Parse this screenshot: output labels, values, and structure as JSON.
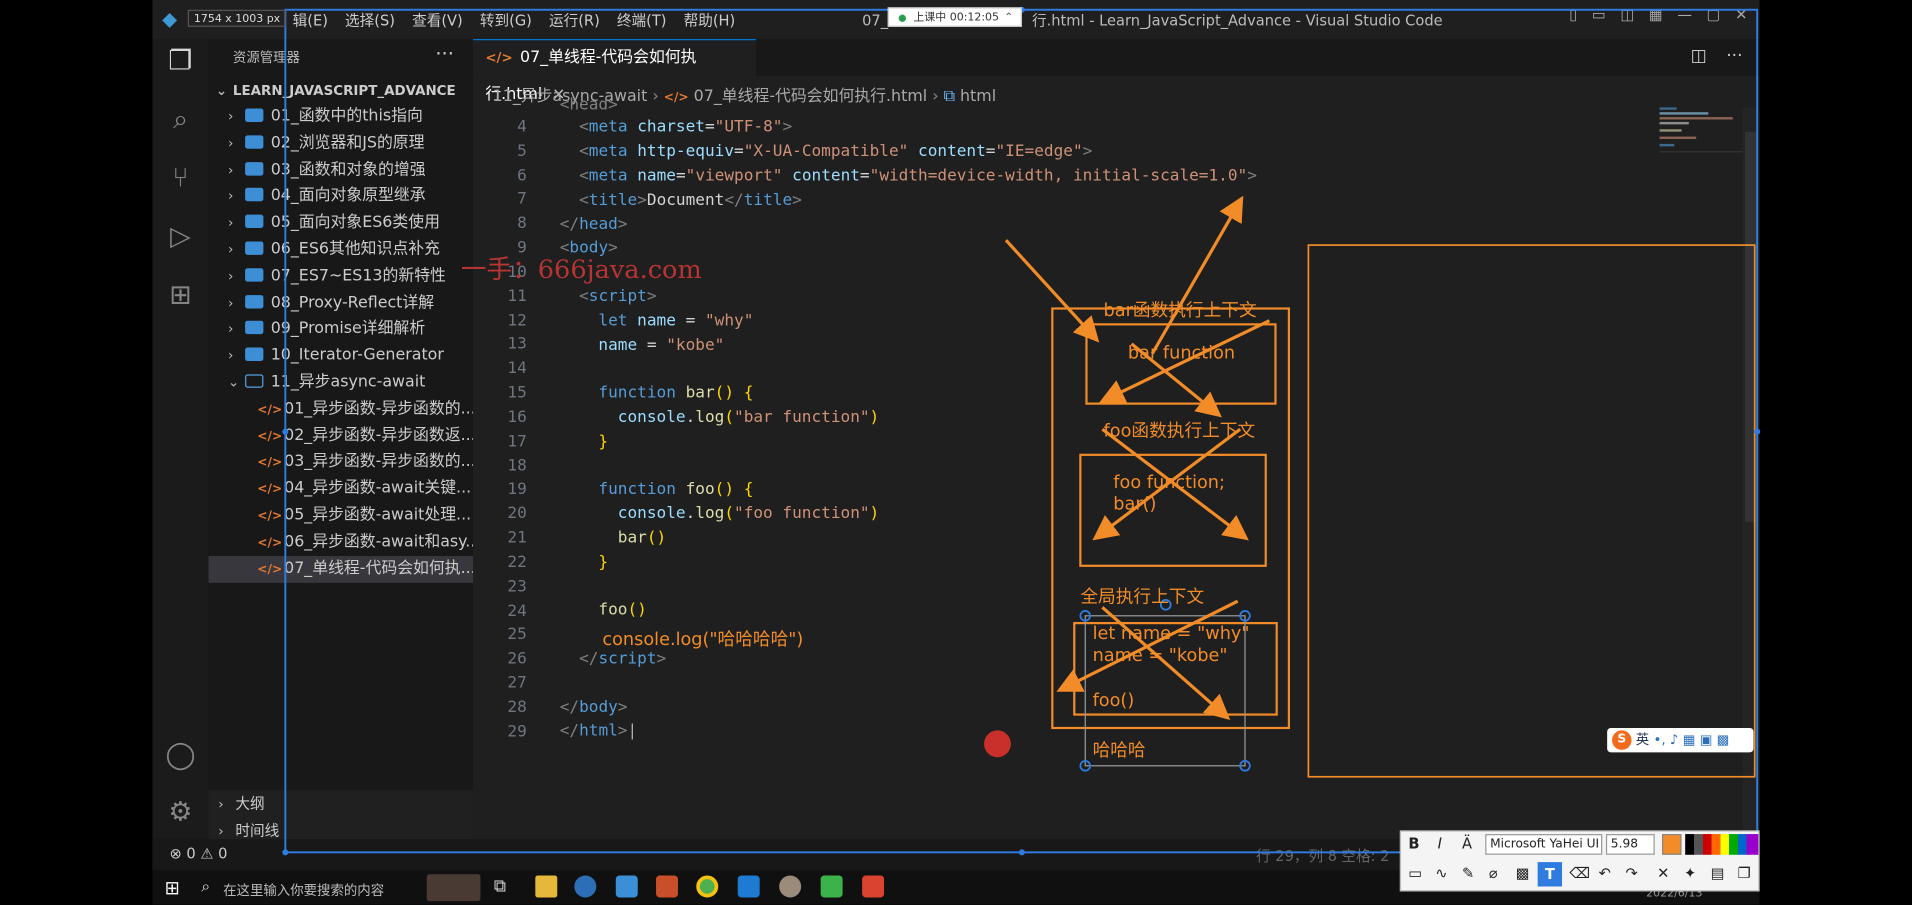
{
  "window": {
    "title": "07_单线程-代码会如何执行.html - Learn_JavaScript_Advance - Visual Studio Code",
    "title_visible": "行.html - Learn_JavaScript_Advance - Visual Studio Code",
    "menus": [
      "辑(E)",
      "选择(S)",
      "查看(V)",
      "转到(G)",
      "运行(R)",
      "终端(T)",
      "帮助(H)"
    ],
    "prefix": "07_"
  },
  "overlay": {
    "dimensions": "1754 x 1003  px",
    "timer_label": "上课中 00:12:05",
    "watermark": "一手：666java.com",
    "ime_label": "英",
    "ime_logo": "S"
  },
  "sidebar": {
    "title": "资源管理器",
    "more": "···",
    "root": "LEARN_JAVASCRIPT_ADVANCE",
    "folders": [
      "01_函数中的this指向",
      "02_浏览器和JS的原理",
      "03_函数和对象的增强",
      "04_面向对象原型继承",
      "05_面向对象ES6类使用",
      "06_ES6其他知识点补充",
      "07_ES7~ES13的新特性",
      "08_Proxy-Reflect详解",
      "09_Promise详细解析",
      "10_Iterator-Generator",
      "11_异步async-await"
    ],
    "files": [
      "01_异步函数-异步函数的...",
      "02_异步函数-异步函数返...",
      "03_异步函数-异步函数的...",
      "04_异步函数-await关键...",
      "05_异步函数-await处理...",
      "06_异步函数-await和asy...",
      "07_单线程-代码会如何执..."
    ],
    "outline": "大纲",
    "timeline": "时间线"
  },
  "editor": {
    "tab_label": "07_单线程-代码会如何执行.html",
    "tab_close": "×",
    "breadcrumb": [
      "11_异步async-await",
      "07_单线程-代码会如何执行.html",
      "html"
    ],
    "line_numbers": [
      "4",
      "5",
      "6",
      "7",
      "8",
      "9",
      "10",
      "11",
      "12",
      "13",
      "14",
      "15",
      "16",
      "17",
      "18",
      "19",
      "20",
      "21",
      "22",
      "23",
      "24",
      "25",
      "26",
      "27",
      "28",
      "29"
    ],
    "partial_top": "<head>"
  },
  "annotations": {
    "bar_context": "bar函数执行上下文",
    "bar_box": "bar function",
    "foo_context": "foo函数执行上下文",
    "foo_box_1": "foo function;",
    "foo_box_2": "bar()",
    "global_context": "全局执行上下文",
    "global_1": "let name = \"why\"",
    "global_2": "name = \"kobe\"",
    "global_3": "foo()",
    "typed_text": "哈哈哈",
    "code_note": "console.log(\"哈哈哈哈\")"
  },
  "statusbar": {
    "problems": "⊗ 0 ⚠ 0",
    "position": "行 29，列 8",
    "spaces": "空格: 2"
  },
  "taskbar": {
    "search_placeholder": "在这里输入你要搜索的内容",
    "date": "2022/6/13"
  },
  "toolbar": {
    "bold": "B",
    "italic": "I",
    "font": "Microsoft YaHei UI",
    "size": "5.98",
    "accent": "#f28c28"
  }
}
